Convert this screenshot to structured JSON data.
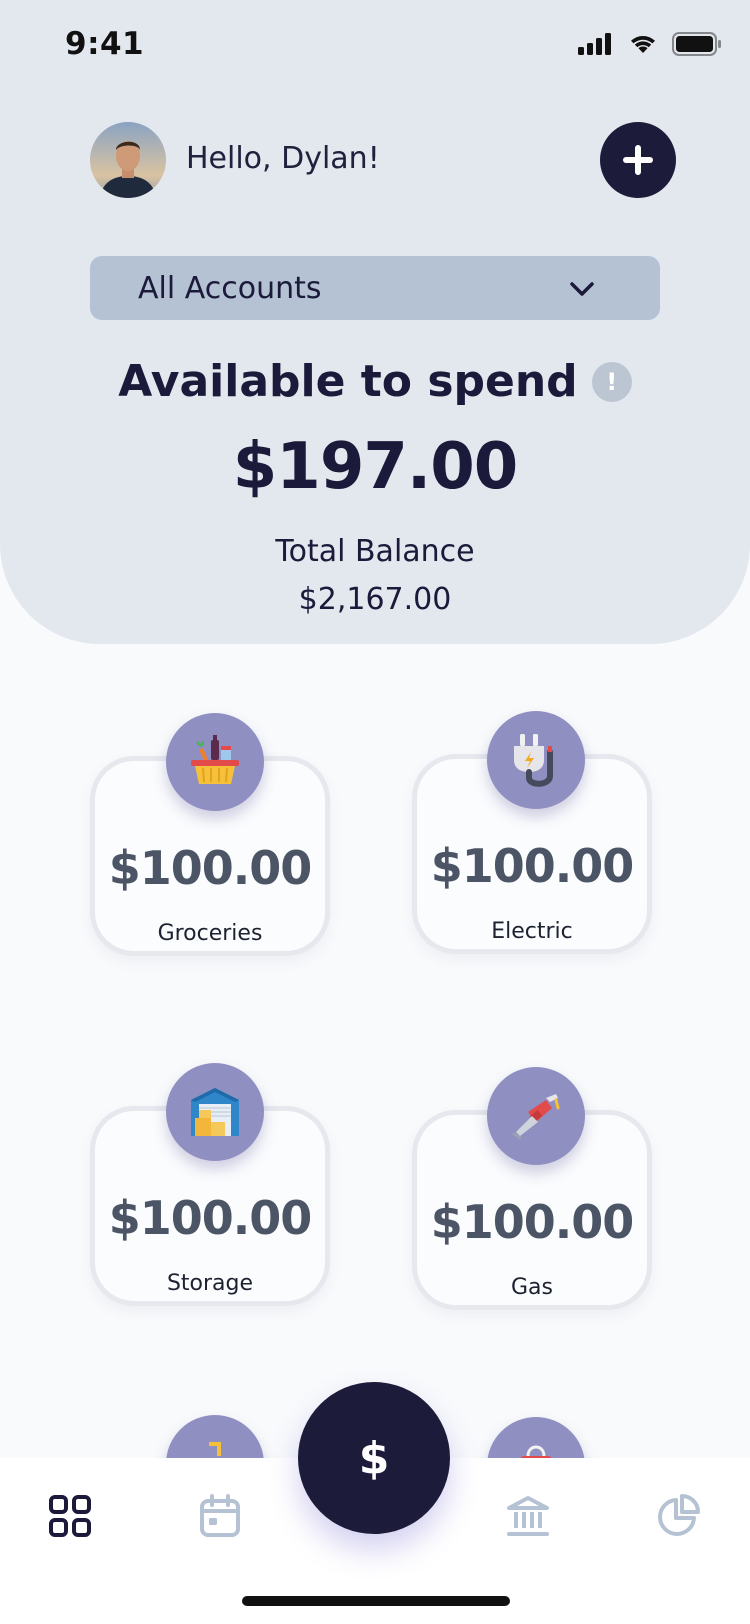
{
  "status_bar": {
    "time": "9:41"
  },
  "header": {
    "greeting": "Hello, Dylan!",
    "account_select": {
      "selected": "All Accounts"
    },
    "available": {
      "title": "Available to spend",
      "amount": "$197.00"
    },
    "total": {
      "label": "Total Balance",
      "amount": "$2,167.00"
    }
  },
  "categories": [
    {
      "amount": "$100.00",
      "label": "Groceries",
      "icon": "grocery-basket-icon"
    },
    {
      "amount": "$100.00",
      "label": "Electric",
      "icon": "electric-plug-icon"
    },
    {
      "amount": "$100.00",
      "label": "Storage",
      "icon": "storage-unit-icon"
    },
    {
      "amount": "$100.00",
      "label": "Gas",
      "icon": "fuel-nozzle-icon"
    }
  ],
  "nav": {
    "items": [
      {
        "name": "dashboard",
        "icon": "grid-icon"
      },
      {
        "name": "calendar",
        "icon": "calendar-icon"
      },
      {
        "name": "accounts",
        "icon": "bank-icon"
      },
      {
        "name": "reports",
        "icon": "pie-chart-icon"
      }
    ],
    "center_button_icon": "dollar-icon",
    "center_button_label": "$"
  },
  "colors": {
    "primary_dark": "#1c1b3a",
    "header_bg": "#e3e7ee",
    "select_bg": "#b5c2d3",
    "icon_circle": "#8f8fc2",
    "card_border": "#e6e8ee",
    "nav_active": "#1b1a3a",
    "nav_inactive": "#b5c2d3"
  }
}
